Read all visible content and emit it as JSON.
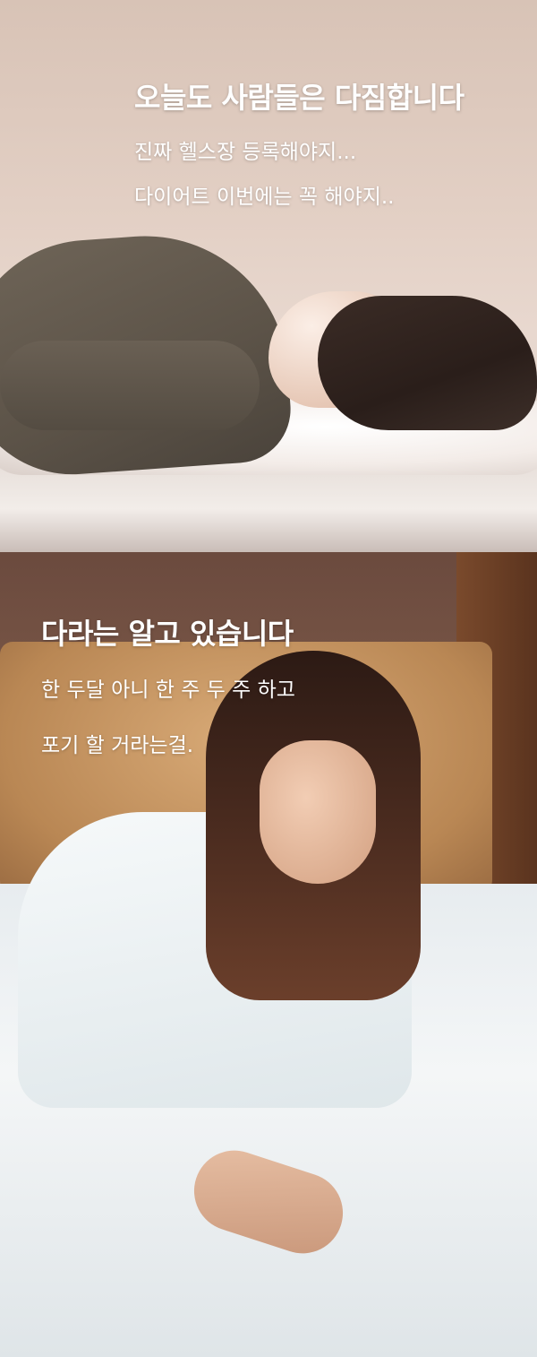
{
  "section1": {
    "headline": "오늘도 사람들은 다짐합니다",
    "lines": [
      "진짜 헬스장 등록해야지...",
      "다이어트 이번에는 꼭 해야지.."
    ]
  },
  "section2": {
    "headline": "다라는 알고 있습니다",
    "lines": [
      "한 두달 아니 한 주 두 주 하고",
      "포기 할 거라는걸."
    ]
  }
}
